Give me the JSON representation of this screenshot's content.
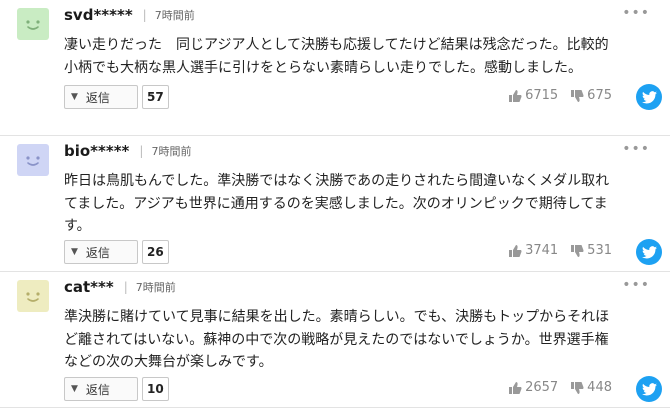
{
  "colors": {
    "twitter": "#1da1f2",
    "avatar_green": "#c9ecc3",
    "avatar_blue": "#cfd5f5",
    "avatar_yellow": "#eeecc0"
  },
  "comments": [
    {
      "user": "svd*****",
      "separator": "|",
      "time": "7時間前",
      "menu": "•••",
      "lines": [
        "凄い走りだった　同じアジア人として決勝も応援してたけど結果は残念だった。比較的",
        "小柄でも大柄な黒人選手に引けをとらない素晴らしい走りでした。感動しました。"
      ],
      "reply_label": "返信",
      "reply_count": "57",
      "likes": "6715",
      "dislikes": "675",
      "avatar_icon": "smiley-face-icon"
    },
    {
      "user": "bio*****",
      "separator": "|",
      "time": "7時間前",
      "menu": "•••",
      "lines": [
        "昨日は鳥肌もんでした。準決勝ではなく決勝であの走りされたら間違いなくメダル取れ",
        "てました。アジアも世界に通用するのを実感しました。次のオリンピックで期待してま",
        "す。"
      ],
      "reply_label": "返信",
      "reply_count": "26",
      "likes": "3741",
      "dislikes": "531",
      "avatar_icon": "smiley-face-icon"
    },
    {
      "user": "cat***",
      "separator": "|",
      "time": "7時間前",
      "menu": "•••",
      "lines": [
        "準決勝に賭けていて見事に結果を出した。素晴らしい。でも、決勝もトップからそれほ",
        "ど離されてはいない。蘇神の中で次の戦略が見えたのではないでしょうか。世界選手権",
        "などの次の大舞台が楽しみです。"
      ],
      "reply_label": "返信",
      "reply_count": "10",
      "likes": "2657",
      "dislikes": "448",
      "avatar_icon": "smiley-face-icon"
    }
  ]
}
